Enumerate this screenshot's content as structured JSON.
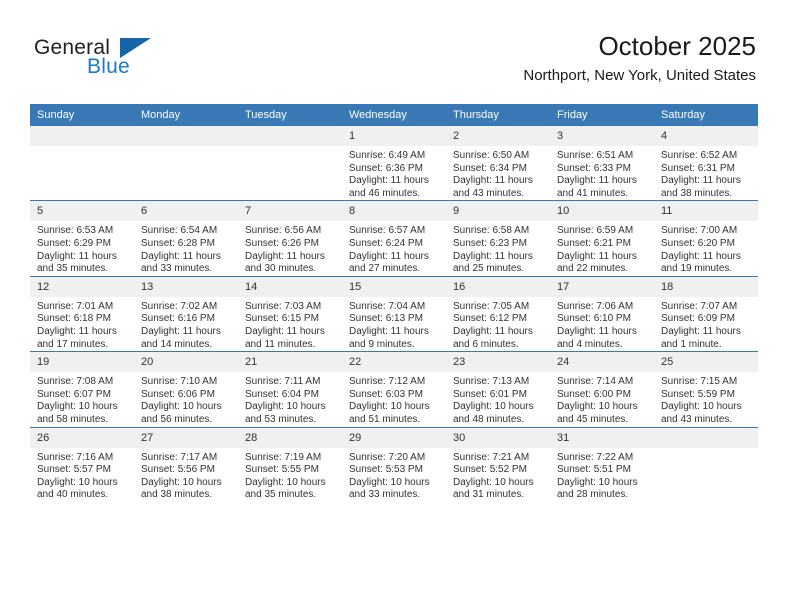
{
  "brand": {
    "name_part1": "General",
    "name_part2": "Blue",
    "accent_color": "#1a7bc4",
    "triangle_color": "#1565a8"
  },
  "header": {
    "title": "October 2025",
    "subtitle": "Northport, New York, United States"
  },
  "calendar": {
    "header_bg": "#3878b4",
    "daynum_bg": "#eff0ef",
    "weekday_headers": [
      "Sunday",
      "Monday",
      "Tuesday",
      "Wednesday",
      "Thursday",
      "Friday",
      "Saturday"
    ],
    "weeks": [
      [
        {
          "day": "",
          "sunrise": "",
          "sunset": "",
          "daylight_line1": "",
          "daylight_line2": ""
        },
        {
          "day": "",
          "sunrise": "",
          "sunset": "",
          "daylight_line1": "",
          "daylight_line2": ""
        },
        {
          "day": "",
          "sunrise": "",
          "sunset": "",
          "daylight_line1": "",
          "daylight_line2": ""
        },
        {
          "day": "1",
          "sunrise": "Sunrise: 6:49 AM",
          "sunset": "Sunset: 6:36 PM",
          "daylight_line1": "Daylight: 11 hours",
          "daylight_line2": "and 46 minutes."
        },
        {
          "day": "2",
          "sunrise": "Sunrise: 6:50 AM",
          "sunset": "Sunset: 6:34 PM",
          "daylight_line1": "Daylight: 11 hours",
          "daylight_line2": "and 43 minutes."
        },
        {
          "day": "3",
          "sunrise": "Sunrise: 6:51 AM",
          "sunset": "Sunset: 6:33 PM",
          "daylight_line1": "Daylight: 11 hours",
          "daylight_line2": "and 41 minutes."
        },
        {
          "day": "4",
          "sunrise": "Sunrise: 6:52 AM",
          "sunset": "Sunset: 6:31 PM",
          "daylight_line1": "Daylight: 11 hours",
          "daylight_line2": "and 38 minutes."
        }
      ],
      [
        {
          "day": "5",
          "sunrise": "Sunrise: 6:53 AM",
          "sunset": "Sunset: 6:29 PM",
          "daylight_line1": "Daylight: 11 hours",
          "daylight_line2": "and 35 minutes."
        },
        {
          "day": "6",
          "sunrise": "Sunrise: 6:54 AM",
          "sunset": "Sunset: 6:28 PM",
          "daylight_line1": "Daylight: 11 hours",
          "daylight_line2": "and 33 minutes."
        },
        {
          "day": "7",
          "sunrise": "Sunrise: 6:56 AM",
          "sunset": "Sunset: 6:26 PM",
          "daylight_line1": "Daylight: 11 hours",
          "daylight_line2": "and 30 minutes."
        },
        {
          "day": "8",
          "sunrise": "Sunrise: 6:57 AM",
          "sunset": "Sunset: 6:24 PM",
          "daylight_line1": "Daylight: 11 hours",
          "daylight_line2": "and 27 minutes."
        },
        {
          "day": "9",
          "sunrise": "Sunrise: 6:58 AM",
          "sunset": "Sunset: 6:23 PM",
          "daylight_line1": "Daylight: 11 hours",
          "daylight_line2": "and 25 minutes."
        },
        {
          "day": "10",
          "sunrise": "Sunrise: 6:59 AM",
          "sunset": "Sunset: 6:21 PM",
          "daylight_line1": "Daylight: 11 hours",
          "daylight_line2": "and 22 minutes."
        },
        {
          "day": "11",
          "sunrise": "Sunrise: 7:00 AM",
          "sunset": "Sunset: 6:20 PM",
          "daylight_line1": "Daylight: 11 hours",
          "daylight_line2": "and 19 minutes."
        }
      ],
      [
        {
          "day": "12",
          "sunrise": "Sunrise: 7:01 AM",
          "sunset": "Sunset: 6:18 PM",
          "daylight_line1": "Daylight: 11 hours",
          "daylight_line2": "and 17 minutes."
        },
        {
          "day": "13",
          "sunrise": "Sunrise: 7:02 AM",
          "sunset": "Sunset: 6:16 PM",
          "daylight_line1": "Daylight: 11 hours",
          "daylight_line2": "and 14 minutes."
        },
        {
          "day": "14",
          "sunrise": "Sunrise: 7:03 AM",
          "sunset": "Sunset: 6:15 PM",
          "daylight_line1": "Daylight: 11 hours",
          "daylight_line2": "and 11 minutes."
        },
        {
          "day": "15",
          "sunrise": "Sunrise: 7:04 AM",
          "sunset": "Sunset: 6:13 PM",
          "daylight_line1": "Daylight: 11 hours",
          "daylight_line2": "and 9 minutes."
        },
        {
          "day": "16",
          "sunrise": "Sunrise: 7:05 AM",
          "sunset": "Sunset: 6:12 PM",
          "daylight_line1": "Daylight: 11 hours",
          "daylight_line2": "and 6 minutes."
        },
        {
          "day": "17",
          "sunrise": "Sunrise: 7:06 AM",
          "sunset": "Sunset: 6:10 PM",
          "daylight_line1": "Daylight: 11 hours",
          "daylight_line2": "and 4 minutes."
        },
        {
          "day": "18",
          "sunrise": "Sunrise: 7:07 AM",
          "sunset": "Sunset: 6:09 PM",
          "daylight_line1": "Daylight: 11 hours",
          "daylight_line2": "and 1 minute."
        }
      ],
      [
        {
          "day": "19",
          "sunrise": "Sunrise: 7:08 AM",
          "sunset": "Sunset: 6:07 PM",
          "daylight_line1": "Daylight: 10 hours",
          "daylight_line2": "and 58 minutes."
        },
        {
          "day": "20",
          "sunrise": "Sunrise: 7:10 AM",
          "sunset": "Sunset: 6:06 PM",
          "daylight_line1": "Daylight: 10 hours",
          "daylight_line2": "and 56 minutes."
        },
        {
          "day": "21",
          "sunrise": "Sunrise: 7:11 AM",
          "sunset": "Sunset: 6:04 PM",
          "daylight_line1": "Daylight: 10 hours",
          "daylight_line2": "and 53 minutes."
        },
        {
          "day": "22",
          "sunrise": "Sunrise: 7:12 AM",
          "sunset": "Sunset: 6:03 PM",
          "daylight_line1": "Daylight: 10 hours",
          "daylight_line2": "and 51 minutes."
        },
        {
          "day": "23",
          "sunrise": "Sunrise: 7:13 AM",
          "sunset": "Sunset: 6:01 PM",
          "daylight_line1": "Daylight: 10 hours",
          "daylight_line2": "and 48 minutes."
        },
        {
          "day": "24",
          "sunrise": "Sunrise: 7:14 AM",
          "sunset": "Sunset: 6:00 PM",
          "daylight_line1": "Daylight: 10 hours",
          "daylight_line2": "and 45 minutes."
        },
        {
          "day": "25",
          "sunrise": "Sunrise: 7:15 AM",
          "sunset": "Sunset: 5:59 PM",
          "daylight_line1": "Daylight: 10 hours",
          "daylight_line2": "and 43 minutes."
        }
      ],
      [
        {
          "day": "26",
          "sunrise": "Sunrise: 7:16 AM",
          "sunset": "Sunset: 5:57 PM",
          "daylight_line1": "Daylight: 10 hours",
          "daylight_line2": "and 40 minutes."
        },
        {
          "day": "27",
          "sunrise": "Sunrise: 7:17 AM",
          "sunset": "Sunset: 5:56 PM",
          "daylight_line1": "Daylight: 10 hours",
          "daylight_line2": "and 38 minutes."
        },
        {
          "day": "28",
          "sunrise": "Sunrise: 7:19 AM",
          "sunset": "Sunset: 5:55 PM",
          "daylight_line1": "Daylight: 10 hours",
          "daylight_line2": "and 35 minutes."
        },
        {
          "day": "29",
          "sunrise": "Sunrise: 7:20 AM",
          "sunset": "Sunset: 5:53 PM",
          "daylight_line1": "Daylight: 10 hours",
          "daylight_line2": "and 33 minutes."
        },
        {
          "day": "30",
          "sunrise": "Sunrise: 7:21 AM",
          "sunset": "Sunset: 5:52 PM",
          "daylight_line1": "Daylight: 10 hours",
          "daylight_line2": "and 31 minutes."
        },
        {
          "day": "31",
          "sunrise": "Sunrise: 7:22 AM",
          "sunset": "Sunset: 5:51 PM",
          "daylight_line1": "Daylight: 10 hours",
          "daylight_line2": "and 28 minutes."
        },
        {
          "day": "",
          "sunrise": "",
          "sunset": "",
          "daylight_line1": "",
          "daylight_line2": ""
        }
      ]
    ]
  }
}
